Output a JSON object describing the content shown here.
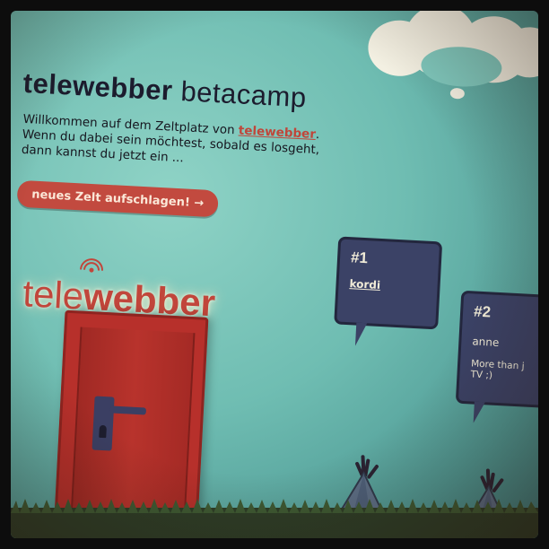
{
  "header": {
    "title_bold": "telewebber",
    "title_regular": " betacamp"
  },
  "intro": {
    "line1_pre": "Willkommen auf dem Zeltplatz von ",
    "link": "telewebber",
    "line1_post": ".",
    "line2": "Wenn du dabei sein möchtest, sobald es losgeht,",
    "line3": "dann kannst du jetzt ein ..."
  },
  "cta": {
    "label": "neues Zelt aufschlagen! →"
  },
  "logo": {
    "part1": "tele",
    "part2": "webber"
  },
  "bubbles": [
    {
      "rank": "#1",
      "user": "kordi",
      "message": ""
    },
    {
      "rank": "#2",
      "user": "anne",
      "message_line1": "More than j",
      "message_line2": "TV ;)"
    }
  ],
  "icons": {
    "antenna": "antenna-icon",
    "cloud": "cloud-graphic",
    "door": "door-graphic",
    "tent": "tent-graphic"
  },
  "colors": {
    "background": "#6fbdb2",
    "accent_red": "#c24a3f",
    "bubble": "#3b4266",
    "text_dark": "#1c1c2e"
  }
}
